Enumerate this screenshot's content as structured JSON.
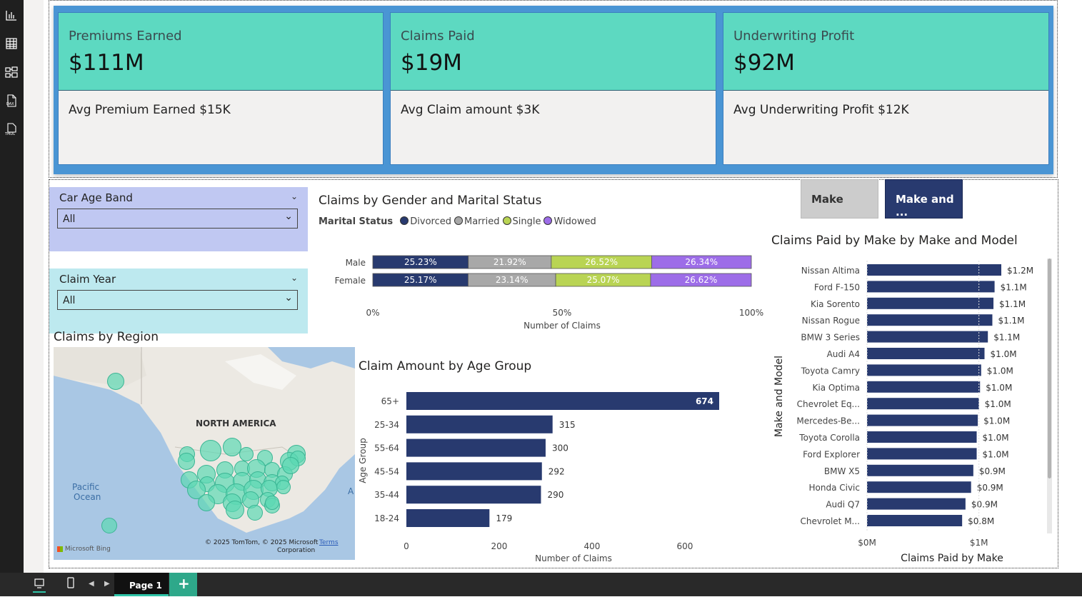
{
  "kpis": [
    {
      "title": "Premiums Earned",
      "value": "$111M",
      "sub": "Avg Premium Earned $15K"
    },
    {
      "title": "Claims Paid",
      "value": "$19M",
      "sub": "Avg Claim amount $3K"
    },
    {
      "title": "Underwriting Profit",
      "value": "$92M",
      "sub": "Avg Underwriting Profit $12K"
    }
  ],
  "slicers": [
    {
      "title": "Car Age Band",
      "value": "All",
      "color": "#c0c8f2"
    },
    {
      "title": "Claim Year",
      "value": "All",
      "color": "#bde9ef"
    }
  ],
  "buttons": {
    "make": "Make",
    "make_model": "Make and ..."
  },
  "map": {
    "title": "Claims by Region",
    "label_continent": "NORTH AMERICA",
    "label_ocean_1": "Pacific",
    "label_ocean_2": "Ocean",
    "label_edge": "A",
    "copyright_1": "© 2025 TomTom, © 2025 Microsoft",
    "copyright_2": "Corporation",
    "terms": "Terms",
    "brand": "Microsoft Bing"
  },
  "gender_chart": {
    "title": "Claims by Gender and Marital Status",
    "legend_title": "Marital Status",
    "xlabel": "Number of Claims",
    "ticks": [
      "0%",
      "50%",
      "100%"
    ],
    "chart_data": {
      "type": "bar",
      "orientation": "horizontal",
      "stacked": "100%",
      "categories": [
        "Male",
        "Female"
      ],
      "series": [
        {
          "name": "Divorced",
          "color": "#283a6f",
          "values": [
            25.23,
            25.17
          ],
          "labels": [
            "25.23%",
            "25.17%"
          ]
        },
        {
          "name": "Married",
          "color": "#a8a8a8",
          "values": [
            21.92,
            23.14
          ],
          "labels": [
            "21.92%",
            "23.14%"
          ]
        },
        {
          "name": "Single",
          "color": "#b9d454",
          "values": [
            26.52,
            25.07
          ],
          "labels": [
            "26.52%",
            "25.07%"
          ]
        },
        {
          "name": "Widowed",
          "color": "#9d6de8",
          "values": [
            26.34,
            26.62
          ],
          "labels": [
            "26.34%",
            "26.62%"
          ]
        }
      ],
      "xlim": [
        0,
        100
      ]
    }
  },
  "age_chart": {
    "title": "Claim Amount by Age Group",
    "xlabel": "Number of Claims",
    "ylabel": "Age Group",
    "ticks": [
      "0",
      "200",
      "400",
      "600"
    ],
    "chart_data": {
      "type": "bar",
      "orientation": "horizontal",
      "categories": [
        "65+",
        "25-34",
        "55-64",
        "45-54",
        "35-44",
        "18-24"
      ],
      "values": [
        674,
        315,
        300,
        292,
        290,
        179
      ],
      "labels": [
        "674",
        "315",
        "300",
        "292",
        "290",
        "179"
      ],
      "xlim": [
        0,
        700
      ],
      "color": "#283a6f"
    }
  },
  "make_chart": {
    "title": "Claims Paid by Make by Make and Model",
    "xlabel": "Claims Paid by Make",
    "ylabel": "Make and Model",
    "ticks": [
      "$0M",
      "$1M"
    ],
    "chart_data": {
      "type": "bar",
      "orientation": "horizontal",
      "categories": [
        "Nissan Altima",
        "Ford F-150",
        "Kia Sorento",
        "Nissan Rogue",
        "BMW 3 Series",
        "Audi A4",
        "Toyota Camry",
        "Kia Optima",
        "Chevrolet Eq...",
        "Mercedes-Be...",
        "Toyota Corolla",
        "Ford Explorer",
        "BMW X5",
        "Honda Civic",
        "Audi Q7",
        "Chevrolet M..."
      ],
      "values": [
        1.2,
        1.14,
        1.13,
        1.12,
        1.08,
        1.05,
        1.02,
        1.01,
        1.0,
        0.99,
        0.98,
        0.98,
        0.95,
        0.93,
        0.88,
        0.85
      ],
      "labels": [
        "$1.2M",
        "$1.1M",
        "$1.1M",
        "$1.1M",
        "$1.1M",
        "$1.0M",
        "$1.0M",
        "$1.0M",
        "$1.0M",
        "$1.0M",
        "$1.0M",
        "$1.0M",
        "$0.9M",
        "$0.9M",
        "$0.9M",
        "$0.8M"
      ],
      "xlim": [
        0,
        1.4
      ],
      "color": "#283a6f"
    }
  },
  "pages": {
    "tab": "Page 1",
    "add": "+"
  },
  "colors": {
    "card_top": "#5dd9c1",
    "kpi_bg": "#4a95d4",
    "navy": "#283a6f"
  }
}
